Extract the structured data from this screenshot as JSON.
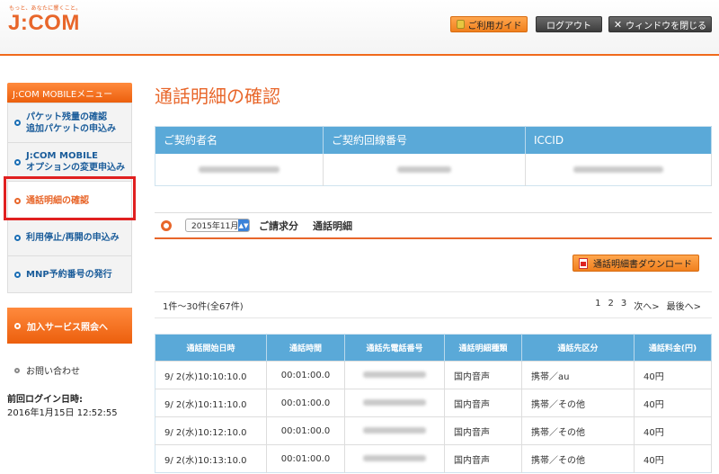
{
  "header": {
    "tagline": "もっと、あなたに響くこと。",
    "logo": "J:COM",
    "guide_label": "ご利用ガイド",
    "logout_label": "ログアウト",
    "close_label": "ウィンドウを閉じる"
  },
  "sidebar": {
    "menu_title": "J:COM MOBILEメニュー",
    "items": [
      {
        "line1": "パケット残量の確認",
        "line2": "追加パケットの申込み"
      },
      {
        "line1": "J:COM MOBILE",
        "line2": "オプションの変更申込み"
      },
      {
        "line1": "通話明細の確認",
        "line2": ""
      },
      {
        "line1": "利用停止/再開の申込み",
        "line2": ""
      },
      {
        "line1": "MNP予約番号の発行",
        "line2": ""
      }
    ],
    "service_button": "加入サービス照会へ",
    "contact": "お問い合わせ",
    "last_login_label": "前回ログイン日時:",
    "last_login_value": "2016年1月15日 12:52:55"
  },
  "main": {
    "title": "通話明細の確認",
    "contract_headers": [
      "ご契約者名",
      "ご契約回線番号",
      "ICCID"
    ],
    "billing": {
      "month": "2015年11月",
      "label": "ご請求分",
      "sublabel": "通話明細"
    },
    "download_label": "通話明細書ダウンロード",
    "pager": {
      "count": "1件〜30件(全67件)",
      "pages": [
        "1",
        "2",
        "3"
      ],
      "next": "次へ>",
      "last": "最後へ>"
    },
    "calls": {
      "headers": [
        "通話開始日時",
        "通話時間",
        "通話先電話番号",
        "通話明細種類",
        "通話先区分",
        "通話料金(円)"
      ],
      "rows": [
        {
          "start": "9/ 2(水)10:10:10.0",
          "duration": "00:01:00.0",
          "type": "国内音声",
          "category": "携帯／au",
          "fee": "40円"
        },
        {
          "start": "9/ 2(水)10:11:10.0",
          "duration": "00:01:00.0",
          "type": "国内音声",
          "category": "携帯／その他",
          "fee": "40円"
        },
        {
          "start": "9/ 2(水)10:12:10.0",
          "duration": "00:01:00.0",
          "type": "国内音声",
          "category": "携帯／その他",
          "fee": "40円"
        },
        {
          "start": "9/ 2(水)10:13:10.0",
          "duration": "00:01:00.0",
          "type": "国内音声",
          "category": "携帯／その他",
          "fee": "40円"
        }
      ]
    }
  }
}
